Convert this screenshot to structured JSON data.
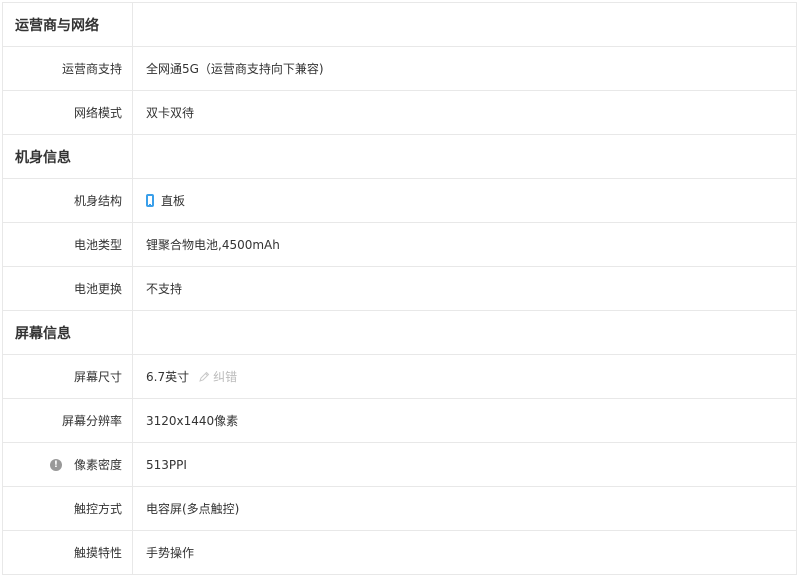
{
  "sections": {
    "network": {
      "title": "运营商与网络"
    },
    "body": {
      "title": "机身信息"
    },
    "screen": {
      "title": "屏幕信息"
    }
  },
  "rows": {
    "carrier_support": {
      "label": "运营商支持",
      "value": "全网通5G（运营商支持向下兼容)"
    },
    "network_mode": {
      "label": "网络模式",
      "value": "双卡双待"
    },
    "body_structure": {
      "label": "机身结构",
      "value": "直板",
      "icon": "phone-bar-icon"
    },
    "battery_type": {
      "label": "电池类型",
      "value": "锂聚合物电池,4500mAh"
    },
    "battery_replace": {
      "label": "电池更换",
      "value": "不支持"
    },
    "screen_size": {
      "label": "屏幕尺寸",
      "value": "6.7英寸",
      "correction_label": "纠错"
    },
    "screen_resolution": {
      "label": "屏幕分辨率",
      "value": "3120x1440像素"
    },
    "pixel_density": {
      "label": "像素密度",
      "value": "513PPI",
      "info_icon_glyph": "!"
    },
    "touch_method": {
      "label": "触控方式",
      "value": "电容屏(多点触控)"
    },
    "touch_features": {
      "label": "触摸特性",
      "value": "手势操作"
    }
  },
  "colors": {
    "border": "#e8e8e8",
    "text": "#333333",
    "accent_icon": "#3a9fea",
    "muted": "#bbbbbb"
  }
}
